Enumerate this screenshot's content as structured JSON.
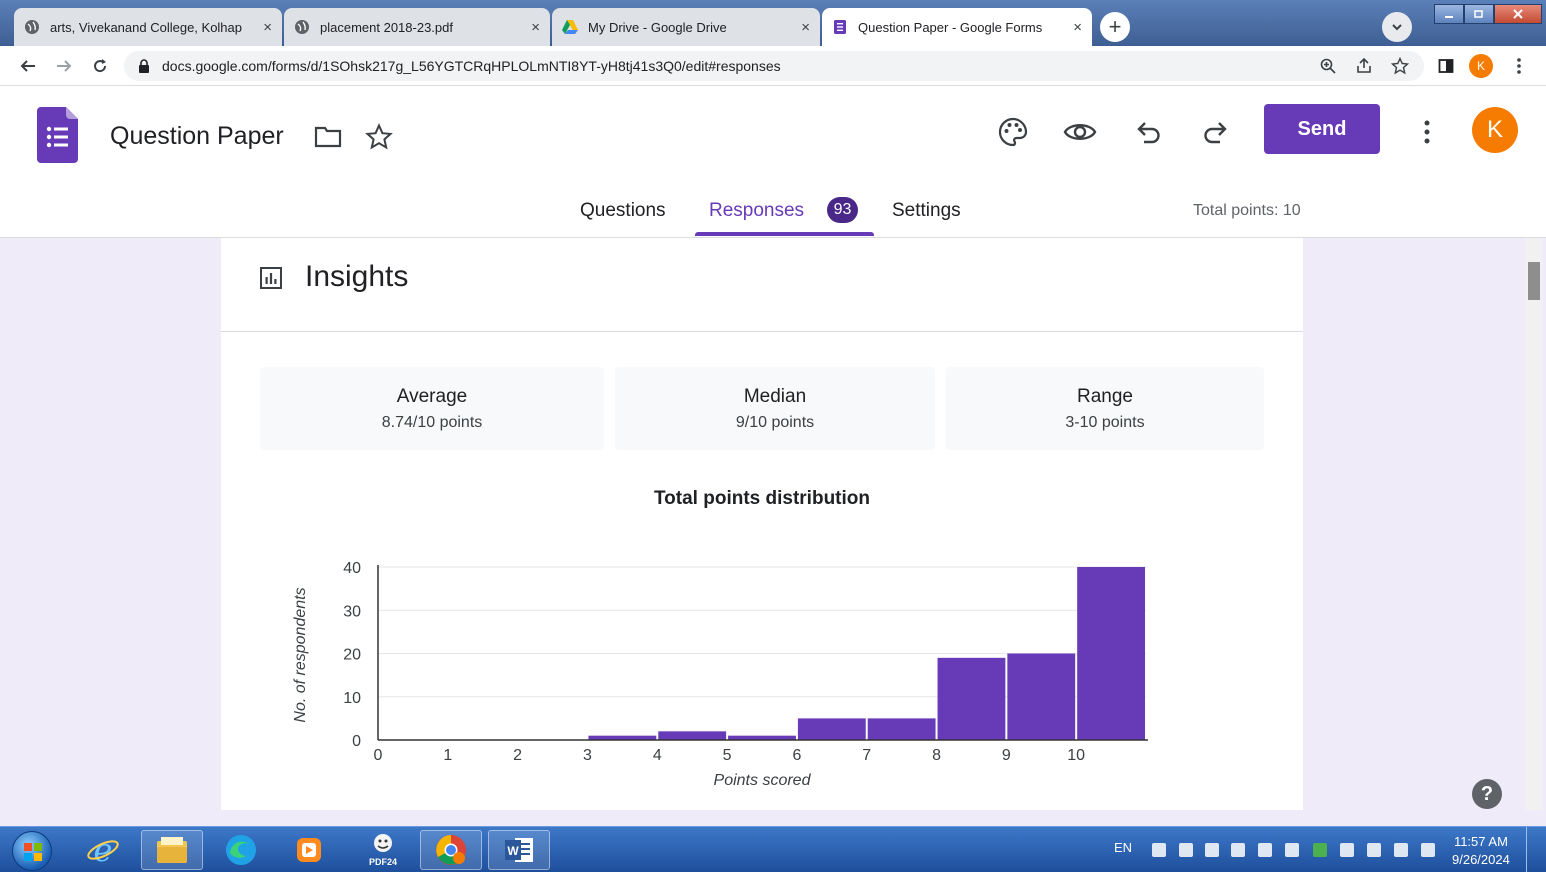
{
  "browser": {
    "tabs": [
      {
        "title": "arts, Vivekanand College, Kolhap",
        "icon": "globe-icon",
        "active": false
      },
      {
        "title": "placement 2018-23.pdf",
        "icon": "globe-icon",
        "active": false
      },
      {
        "title": "My Drive - Google Drive",
        "icon": "google-drive-icon",
        "active": false
      },
      {
        "title": "Question Paper - Google Forms",
        "icon": "google-forms-icon",
        "active": true
      }
    ],
    "close_symbol": "×",
    "new_tab_symbol": "+",
    "url": "docs.google.com/forms/d/1SOhsk217g_L56YGTCRqHPLOLmNTI8YT-yH8tj41s3Q0/edit#responses",
    "profile_initial": "K"
  },
  "form": {
    "title": "Question Paper",
    "send_label": "Send",
    "avatar_initial": "K",
    "tabs": {
      "questions": "Questions",
      "responses": "Responses",
      "responses_count": "93",
      "settings": "Settings"
    },
    "total_points": "Total points: 10"
  },
  "insights": {
    "title": "Insights",
    "stats": [
      {
        "label": "Average",
        "value": "8.74/10 points"
      },
      {
        "label": "Median",
        "value": "9/10 points"
      },
      {
        "label": "Range",
        "value": "3-10 points"
      }
    ]
  },
  "chart_data": {
    "type": "bar",
    "title": "Total points distribution",
    "xlabel": "Points scored",
    "ylabel": "No. of respondents",
    "categories": [
      "0",
      "1",
      "2",
      "3",
      "4",
      "5",
      "6",
      "7",
      "8",
      "9",
      "10"
    ],
    "values": [
      0,
      0,
      0,
      1,
      2,
      1,
      5,
      5,
      19,
      20,
      40
    ],
    "yticks": [
      "0",
      "10",
      "20",
      "30",
      "40"
    ],
    "ylim": [
      0,
      40
    ],
    "bar_color": "#673ab7",
    "grid": true
  },
  "help_symbol": "?",
  "taskbar": {
    "language": "EN",
    "time": "11:57 AM",
    "date": "9/26/2024",
    "pdf_label": "PDF24"
  },
  "colors": {
    "accent": "#673ab7",
    "badge": "#4a2888",
    "avatar": "#f57c00",
    "page_bg": "#f0ebf8"
  }
}
